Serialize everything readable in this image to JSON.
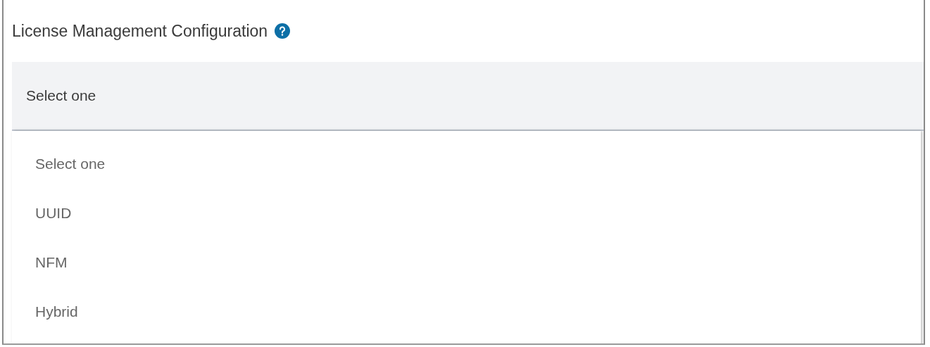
{
  "title": "License Management Configuration",
  "select": {
    "value": "Select one",
    "expanded": true
  },
  "options": [
    {
      "label": "Select one",
      "selected": false
    },
    {
      "label": "UUID",
      "selected": false
    },
    {
      "label": "NFM",
      "selected": false
    },
    {
      "label": "Hybrid",
      "selected": false
    }
  ]
}
